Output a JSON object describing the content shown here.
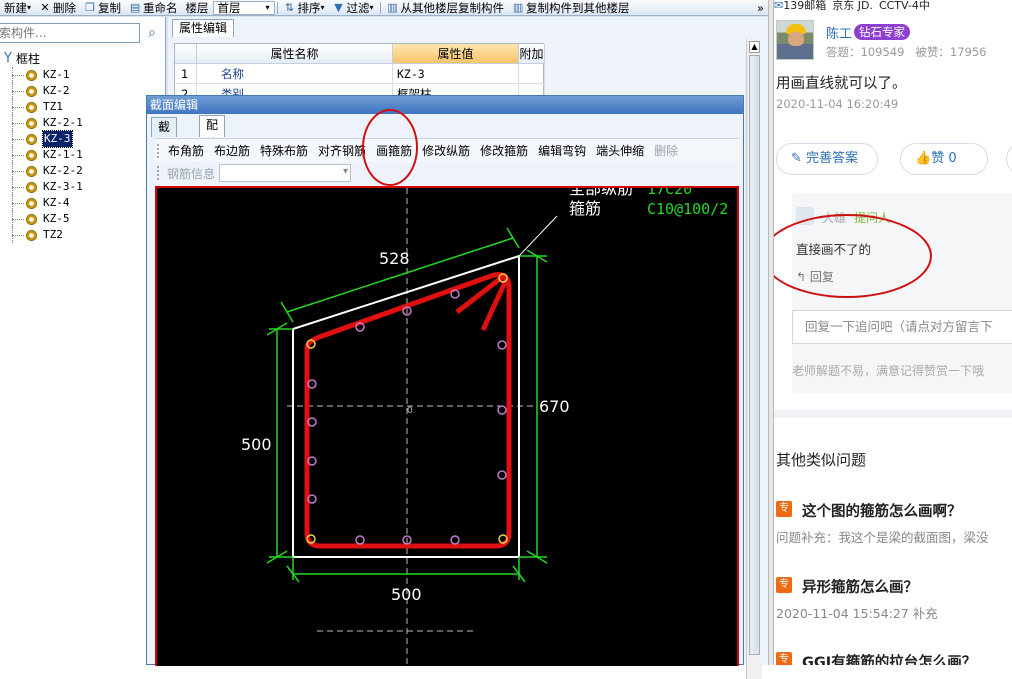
{
  "toolbar": {
    "new": "新建",
    "delete": "删除",
    "copy": "复制",
    "rename": "重命名",
    "floor_label": "楼层",
    "floor_value": "首层",
    "sort": "排序",
    "filter": "过滤",
    "copy_from_floor": "从其他楼层复制构件",
    "copy_to_floor": "复制构件到其他楼层",
    "overflow": "»"
  },
  "left": {
    "search_placeholder": "索构件...",
    "root": "框柱",
    "items": [
      "KZ-1",
      "KZ-2",
      "TZ1",
      "KZ-2-1",
      "KZ-3",
      "KZ-1-1",
      "KZ-2-2",
      "KZ-3-1",
      "KZ-4",
      "KZ-5",
      "TZ2"
    ]
  },
  "props": {
    "tab": "属性编辑",
    "headers": [
      "属性名称",
      "属性值",
      "附加"
    ],
    "rows": [
      {
        "num": "1",
        "name": "名称",
        "value": "KZ-3"
      },
      {
        "num": "2",
        "name": "类别",
        "value": "框架柱"
      }
    ]
  },
  "dialog": {
    "title": "截面编辑",
    "tabs": [
      "截面",
      "配筋"
    ],
    "tools": [
      "布角筋",
      "布边筋",
      "特殊布筋",
      "对齐钢筋",
      "画箍筋",
      "修改纵筋",
      "修改箍筋",
      "编辑弯钩",
      "端头伸缩",
      "删除"
    ],
    "info_label": "钢筋信息"
  },
  "drawing": {
    "top_dim": "528",
    "left_dim": "500",
    "right_dim": "670",
    "bottom_dim": "500",
    "origin": "0",
    "label_all": "全部纵筋",
    "label_all_value": "17C20",
    "label_stirrup": "箍筋",
    "label_stirrup_value": "C10@100/2"
  },
  "web": {
    "bookmarks": [
      "139邮箱",
      "京东 JD.",
      "CCTV-4中"
    ],
    "user": "陈工",
    "badge": "钻石专家",
    "answers_label": "答题：",
    "answers": "109549",
    "adopted_label": "被赞：",
    "adopted": "17956",
    "answer": "用画直线就可以了。",
    "answer_time": "2020-11-04 16:20:49",
    "improve": "完善答案",
    "like": "赞 0",
    "reply_user": "大雄",
    "reply_role": "提问人",
    "reply_text": "直接画不了的",
    "reply_btn": "回复",
    "reply_placeholder": "回复一下追问吧（请点对方留言下",
    "hint": "老师解题不易，满意记得赞赏一下哦",
    "similar_title": "其他类似问题",
    "q_badge": "专",
    "q1": "这个图的箍筋怎么画啊？",
    "q1_sub": "问题补充：我这个是梁的截面图，梁没",
    "q2": "异形箍筋怎么画？",
    "q2_sub": "2020-11-04 15:54:27 补充",
    "q3": "GGJ有箍筋的拉台怎么画？"
  }
}
